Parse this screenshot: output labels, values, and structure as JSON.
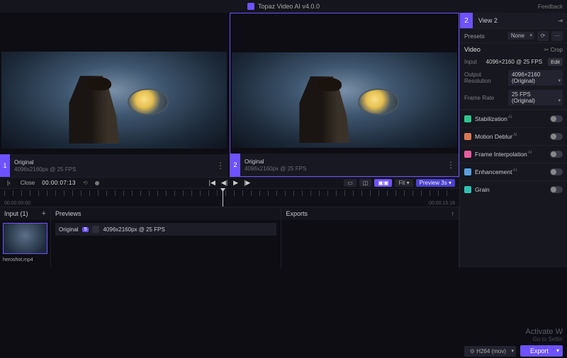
{
  "titlebar": {
    "app_name": "Topaz Video AI  v4.0.0",
    "feedback": "Feedback"
  },
  "viewports": [
    {
      "num": "1",
      "label": "Original",
      "meta": "4096x2160px @ 25 FPS"
    },
    {
      "num": "2",
      "label": "Original",
      "meta": "4096x2160px @ 25 FPS"
    }
  ],
  "sidebar": {
    "num": "2",
    "title": "View 2",
    "presets": {
      "label": "Presets",
      "value": "None"
    },
    "video": {
      "title": "Video",
      "crop": "Crop",
      "input": {
        "label": "Input",
        "value": "4096×2160 @ 25 FPS",
        "edit": "Edit"
      },
      "output_res": {
        "label": "Output Resolution",
        "value": "4096×2160 (Original)"
      },
      "framerate": {
        "label": "Frame Rate",
        "value": "25 FPS (Original)"
      }
    },
    "toggles": [
      {
        "label": "Stabilization",
        "ai": true,
        "color": "#31c48d"
      },
      {
        "label": "Motion Deblur",
        "ai": true,
        "color": "#d97757"
      },
      {
        "label": "Frame Interpolation",
        "ai": true,
        "color": "#e85d9e"
      },
      {
        "label": "Enhancement",
        "ai": true,
        "color": "#5aa0e0"
      },
      {
        "label": "Grain",
        "ai": false,
        "color": "#30c0b0"
      }
    ]
  },
  "transport": {
    "close": "Close",
    "timecode": "00:00:07:13",
    "preview_label": "Preview 3s",
    "fit_label": "Fit"
  },
  "timeline": {
    "start": "00:00:00:00",
    "end": "00:00:15:18"
  },
  "bottom": {
    "input": {
      "title": "Input (1)",
      "filename": "heroshot.mp4"
    },
    "previews": {
      "title": "Previews",
      "row_label": "Original",
      "row_meta": "4096x2160px @ 25 FPS",
      "badge": "5"
    },
    "exports": {
      "title": "Exports"
    }
  },
  "export": {
    "codec": "H264 (mov)",
    "button": "Export"
  },
  "watermark": {
    "l1": "Activate W",
    "l2": "Go to Settin"
  }
}
